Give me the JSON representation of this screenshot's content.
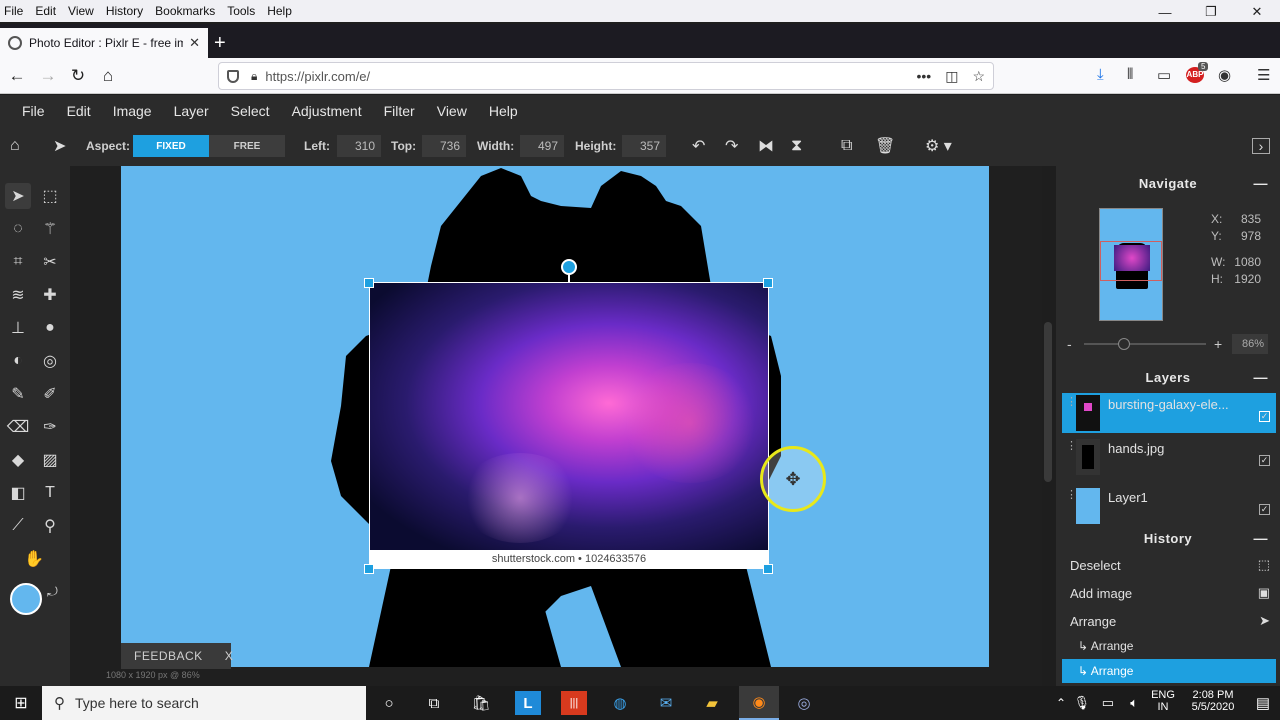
{
  "browser": {
    "menu": [
      "File",
      "Edit",
      "View",
      "History",
      "Bookmarks",
      "Tools",
      "Help"
    ],
    "tab_title": "Photo Editor : Pixlr E - free ima",
    "url": "https://pixlr.com/e/",
    "abp_badge": "5"
  },
  "app": {
    "menu": [
      "File",
      "Edit",
      "Image",
      "Layer",
      "Select",
      "Adjustment",
      "Filter",
      "View",
      "Help"
    ],
    "options": {
      "aspect_label": "Aspect:",
      "fixed": "FIXED",
      "free": "FREE",
      "left_label": "Left:",
      "left_value": "310",
      "top_label": "Top:",
      "top_value": "736",
      "width_label": "Width:",
      "width_value": "497",
      "height_label": "Height:",
      "height_value": "357"
    },
    "canvas": {
      "watermark": "shutterstock.com • 1024633576",
      "feedback": "FEEDBACK",
      "feedback_close": "X",
      "doc_info": "1080 x 1920 px @ 86%"
    },
    "navigate": {
      "title": "Navigate",
      "x_label": "X:",
      "x_value": "835",
      "y_label": "Y:",
      "y_value": "978",
      "w_label": "W:",
      "w_value": "1080",
      "h_label": "H:",
      "h_value": "1920",
      "zoom_minus": "-",
      "zoom_plus": "+",
      "zoom": "86%"
    },
    "layers": {
      "title": "Layers",
      "items": [
        {
          "name": "bursting-galaxy-ele...",
          "selected": true
        },
        {
          "name": "hands.jpg",
          "selected": false
        },
        {
          "name": "Layer1",
          "selected": false
        }
      ]
    },
    "history": {
      "title": "History",
      "items": [
        {
          "label": "Deselect"
        },
        {
          "label": "Add image"
        },
        {
          "label": "Arrange"
        },
        {
          "label": "↳ Arrange"
        },
        {
          "label": "↳ Arrange"
        }
      ]
    },
    "colors": {
      "accent": "#1ea0e0",
      "primary_swatch": "#63b7ee",
      "secondary_swatch": "#000000",
      "canvas_bg": "#63b7ee"
    }
  },
  "taskbar": {
    "search_placeholder": "Type here to search",
    "lang": "ENG",
    "region": "IN",
    "time": "2:08 PM",
    "date": "5/5/2020"
  }
}
